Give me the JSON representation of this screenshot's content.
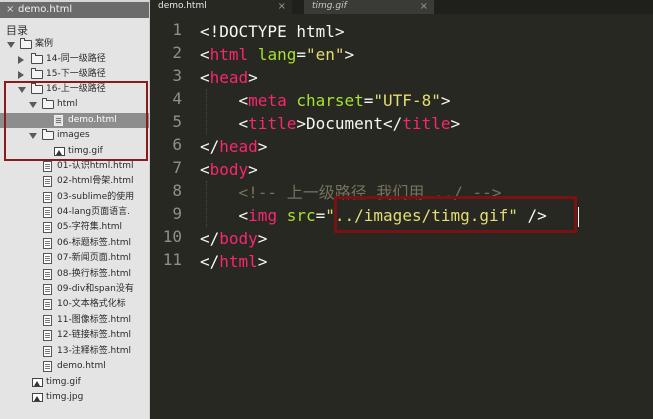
{
  "sidebar": {
    "open_file": "demo.html",
    "folders_label": "目录",
    "tree": [
      {
        "label": "案例",
        "kind": "folder",
        "expanded": true,
        "depth": 0
      },
      {
        "label": "14-同一级路径",
        "kind": "folder",
        "expanded": false,
        "depth": 1
      },
      {
        "label": "15-下一级路径",
        "kind": "folder",
        "expanded": false,
        "depth": 1
      },
      {
        "label": "16-上一级路径",
        "kind": "folder",
        "expanded": true,
        "depth": 1
      },
      {
        "label": "html",
        "kind": "folder",
        "expanded": true,
        "depth": 2
      },
      {
        "label": "demo.html",
        "kind": "file",
        "depth": 3,
        "selected": true
      },
      {
        "label": "images",
        "kind": "folder",
        "expanded": true,
        "depth": 2
      },
      {
        "label": "timg.gif",
        "kind": "image",
        "depth": 3
      },
      {
        "label": "01-认识html.html",
        "kind": "file",
        "depth": 2
      },
      {
        "label": "02-html骨架.html",
        "kind": "file",
        "depth": 2
      },
      {
        "label": "03-sublime的使用",
        "kind": "file",
        "depth": 2
      },
      {
        "label": "04-lang页面语言.",
        "kind": "file",
        "depth": 2
      },
      {
        "label": "05-字符集.html",
        "kind": "file",
        "depth": 2
      },
      {
        "label": "06-标题标签.html",
        "kind": "file",
        "depth": 2
      },
      {
        "label": "07-新闻页面.html",
        "kind": "file",
        "depth": 2
      },
      {
        "label": "08-换行标签.html",
        "kind": "file",
        "depth": 2
      },
      {
        "label": "09-div和span没有",
        "kind": "file",
        "depth": 2
      },
      {
        "label": "10-文本格式化标",
        "kind": "file",
        "depth": 2
      },
      {
        "label": "11-图像标签.html",
        "kind": "file",
        "depth": 2
      },
      {
        "label": "12-链接标签.html",
        "kind": "file",
        "depth": 2
      },
      {
        "label": "13-注释标签.html",
        "kind": "file",
        "depth": 2
      },
      {
        "label": "demo.html",
        "kind": "file",
        "depth": 2
      },
      {
        "label": "timg.gif",
        "kind": "image",
        "depth": 1
      },
      {
        "label": "timg.jpg",
        "kind": "image",
        "depth": 1
      }
    ]
  },
  "tabs": [
    {
      "label": "demo.html",
      "active": true,
      "close": "×"
    },
    {
      "label": "timg.gif",
      "active": false,
      "close": "×"
    }
  ],
  "line_numbers": [
    "1",
    "2",
    "3",
    "4",
    "5",
    "6",
    "7",
    "8",
    "9",
    "10",
    "11"
  ],
  "code": {
    "l1": {
      "text": "<!DOCTYPE html>"
    },
    "l2": {
      "lt": "<",
      "tag": "html",
      "attr": " lang",
      "eq": "=",
      "val": "\"en\"",
      "gt": ">"
    },
    "l3": {
      "lt": "<",
      "tag": "head",
      "gt": ">"
    },
    "l4": {
      "indent": "    ",
      "lt": "<",
      "tag": "meta",
      "attr": " charset",
      "eq": "=",
      "val": "\"UTF-8\"",
      "gt": ">"
    },
    "l5": {
      "indent": "    ",
      "lt": "<",
      "tag": "title",
      "gt": ">",
      "text": "Document",
      "lt2": "</",
      "tag2": "title",
      "gt2": ">"
    },
    "l6": {
      "lt": "</",
      "tag": "head",
      "gt": ">"
    },
    "l7": {
      "lt": "<",
      "tag": "body",
      "gt": ">"
    },
    "l8": {
      "indent": "    ",
      "comment": "<!-- 上一级路径 我们用 ../ -->"
    },
    "l9": {
      "indent": "    ",
      "lt": "<",
      "tag": "img",
      "attr": " src",
      "eq": "=",
      "val": "\"../images/timg.gif\"",
      "sp": " ",
      "end": "/>"
    },
    "l10": {
      "lt": "</",
      "tag": "body",
      "gt": ">"
    },
    "l11": {
      "lt": "</",
      "tag": "html",
      "gt": ">"
    }
  },
  "colors": {
    "editor_bg": "#272822",
    "tag": "#f92672",
    "attribute": "#a6e22e",
    "string": "#e6db74",
    "comment": "#75715e",
    "highlight_box": "#8b1a1a"
  }
}
